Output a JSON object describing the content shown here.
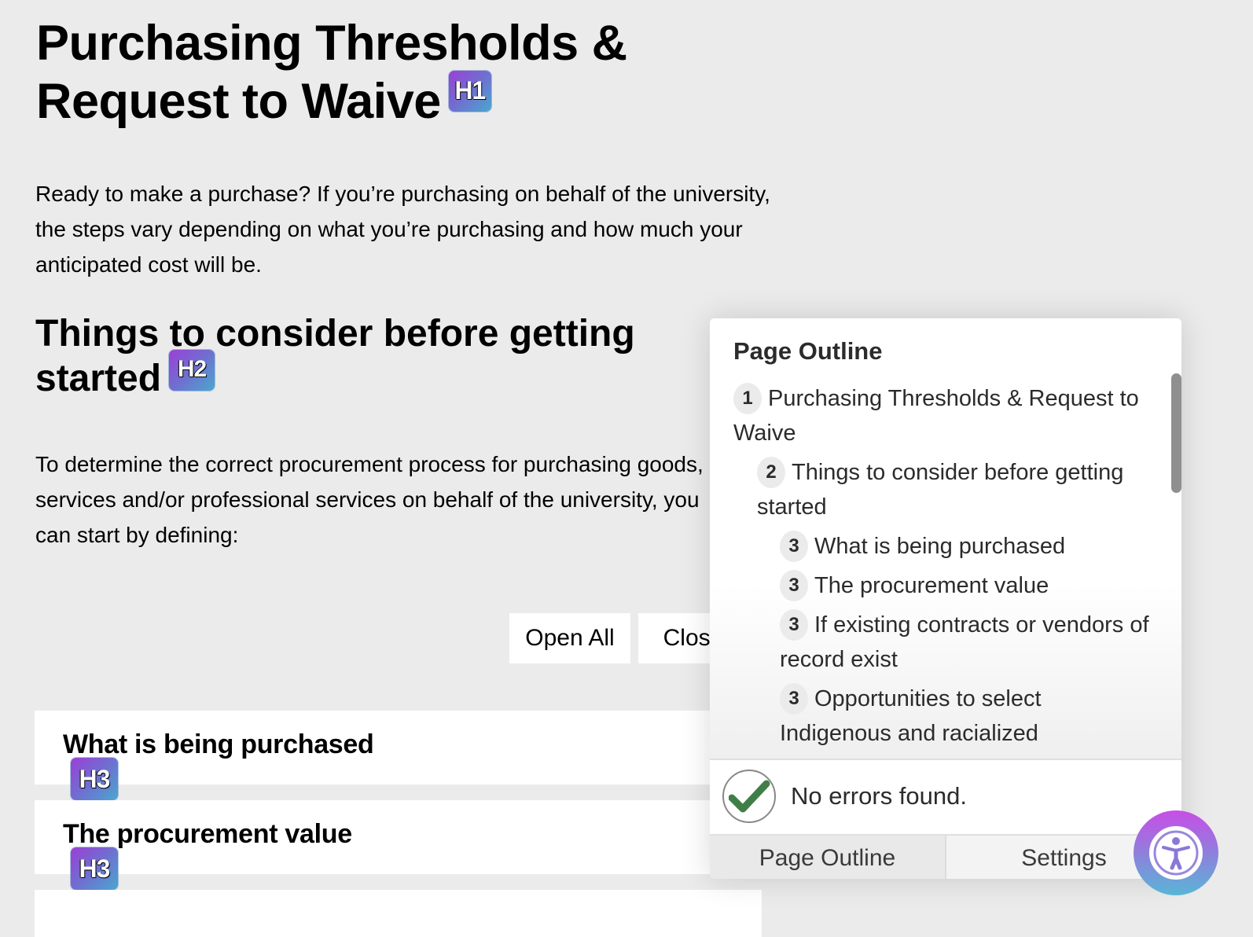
{
  "page": {
    "title": "Purchasing Thresholds & Request to Waive",
    "title_badge": "H1",
    "intro": "Ready to make a purchase? If you’re purchasing on behalf of the university, the steps vary depending on what you’re purchasing and how much your anticipated cost will be.",
    "section_heading": "Things to consider before getting started",
    "section_badge": "H2",
    "section_text": "To determine the correct procurement process for purchasing goods, services and/or professional services on behalf of the university, you can start by defining:",
    "buttons": {
      "open_all": "Open All",
      "close_all": "Close"
    },
    "accordions": [
      {
        "title": "What is being purchased",
        "badge": "H3"
      },
      {
        "title": "The procurement value",
        "badge": "H3"
      }
    ]
  },
  "outline_panel": {
    "title": "Page Outline",
    "items": [
      {
        "level": "1",
        "text": "Purchasing Thresholds & Request to Waive"
      },
      {
        "level": "2",
        "text": "Things to consider before getting started"
      },
      {
        "level": "3",
        "text": "What is being purchased"
      },
      {
        "level": "3",
        "text": "The procurement value"
      },
      {
        "level": "3",
        "text": "If existing contracts or vendors of record exist"
      },
      {
        "level": "3",
        "text": "Opportunities to select Indigenous and racialized"
      }
    ],
    "status_text": "No errors found.",
    "status_icon": "check-circle-icon",
    "tabs": [
      {
        "label": "Page Outline",
        "active": true
      },
      {
        "label": "Settings",
        "active": false
      }
    ]
  },
  "accessibility_button": {
    "icon": "accessibility-person-icon"
  },
  "colors": {
    "background": "#ebebeb",
    "badge_gradient_start": "#9b3fd6",
    "badge_gradient_end": "#4aa8cf",
    "success_green": "#3f7f47",
    "a11y_gradient_top": "#c84ee6",
    "a11y_gradient_bottom": "#58b6d6"
  }
}
